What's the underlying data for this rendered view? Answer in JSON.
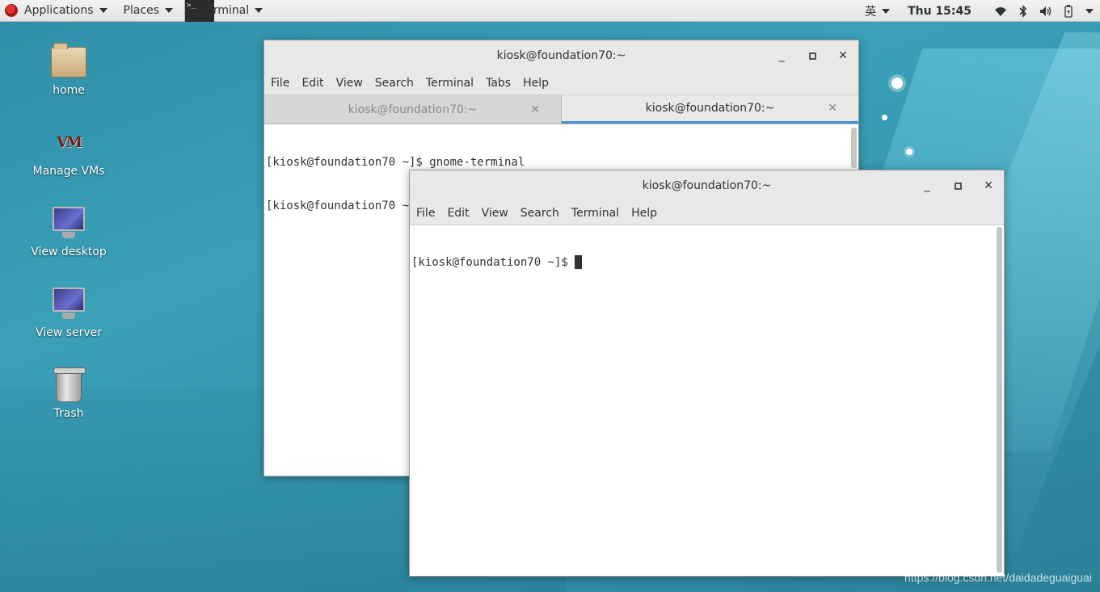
{
  "topbar": {
    "applications": "Applications",
    "places": "Places",
    "active_app": "Terminal",
    "input_method": "英",
    "clock": "Thu 15:45"
  },
  "desktop": {
    "icons": [
      {
        "label": "home"
      },
      {
        "label": "Manage VMs"
      },
      {
        "label": "View desktop"
      },
      {
        "label": "View server"
      },
      {
        "label": "Trash"
      }
    ]
  },
  "window_back": {
    "title": "kiosk@foundation70:~",
    "menu": [
      "File",
      "Edit",
      "View",
      "Search",
      "Terminal",
      "Tabs",
      "Help"
    ],
    "tabs": [
      {
        "label": "kiosk@foundation70:~",
        "active": false
      },
      {
        "label": "kiosk@foundation70:~",
        "active": true
      }
    ],
    "lines": [
      "[kiosk@foundation70 ~]$ gnome-terminal",
      "[kiosk@foundation70 ~]$ "
    ]
  },
  "window_front": {
    "title": "kiosk@foundation70:~",
    "menu": [
      "File",
      "Edit",
      "View",
      "Search",
      "Terminal",
      "Help"
    ],
    "lines": [
      "[kiosk@foundation70 ~]$ "
    ]
  },
  "watermark": "https://blog.csdn.net/daidadeguaiguai",
  "colors": {
    "accent_tab": "#4a90d9",
    "desktop_bg": "#3aa0b8"
  }
}
